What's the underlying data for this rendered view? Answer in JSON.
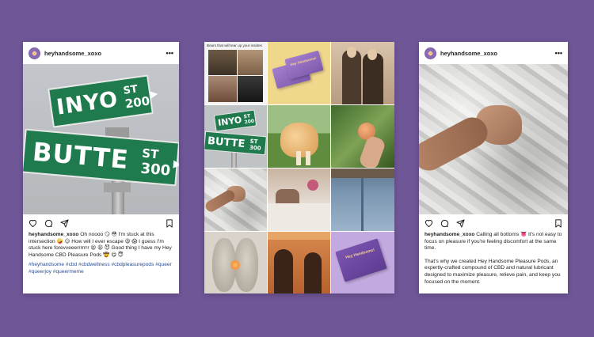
{
  "colors": {
    "background": "#6f5697",
    "hashtag": "#2d4d8c",
    "brand_purple": "#8a6bb3"
  },
  "left_post": {
    "username": "heyhandsome_xoxo",
    "more_icon": "•••",
    "sign_text": {
      "street1_name": "INYO",
      "street1_suffix": "ST",
      "street1_number": "200",
      "street2_name": "BUTTE",
      "street2_suffix": "ST",
      "street2_number": "300"
    },
    "caption_user": "heyhandsome_xoxo",
    "caption_text": "Oh noooo 😏 😳  I'm stuck at this intersection 🤪 😉  How will I ever escape 😩 😱  I guess I'm stuck here forevveeerrrrrrr 😫 😩 😈  Good thing I have my Hey Handsome CBD Pleasure Pods 🤠 😋 😇",
    "hashtags": "#heyhandsome #cbd #cbdwellness #cbdpleasurepods #queer #queerjoy #queermeme"
  },
  "grid": {
    "meme_caption": "Bears that will tear up your insides",
    "box_label_1": "Hey Handsome!",
    "box_label_2": "Hey Handsome!",
    "sign_small": {
      "street1_name": "INYO",
      "street1_suffix": "ST",
      "street1_number": "200",
      "street2_name": "BUTTE",
      "street2_suffix": "ST",
      "street2_number": "300"
    }
  },
  "right_post": {
    "username": "heyhandsome_xoxo",
    "more_icon": "•••",
    "caption_user": "heyhandsome_xoxo",
    "caption_text": "Calling all bottoms 👅 It's not easy to focus on pleasure if you're feeling discomfort at the same time.",
    "caption_text_2": "That's why we created Hey Handsome Pleasure Pods, an expertly-crafted compound of CBD and natural lubricant designed to maximize pleasure, relieve pain, and keep you focused on the moment."
  }
}
